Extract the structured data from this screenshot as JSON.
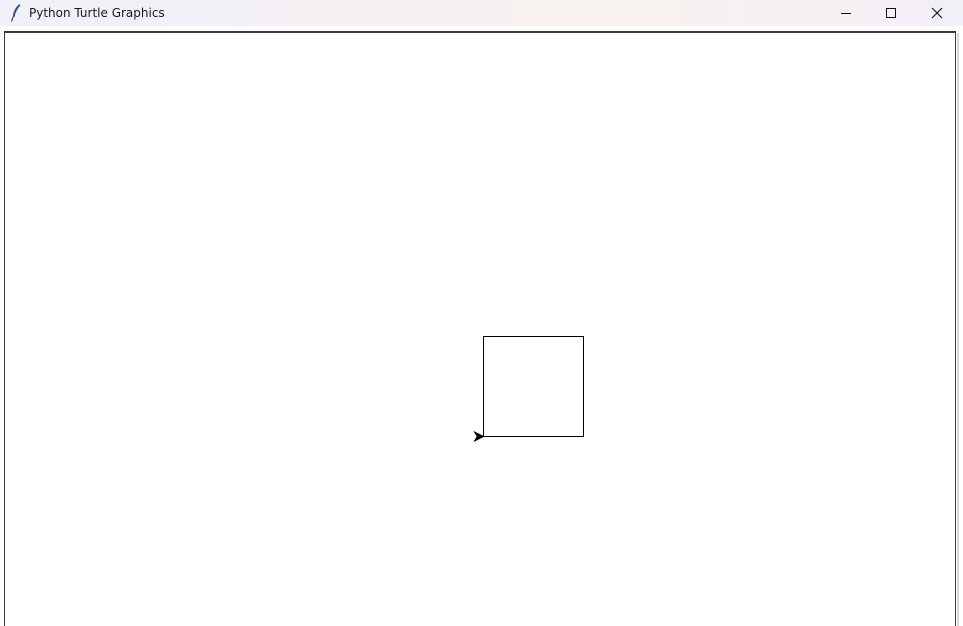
{
  "window": {
    "title": "Python Turtle Graphics",
    "icon": "feather-icon",
    "controls": {
      "minimize": "minimize-icon",
      "maximize": "maximize-icon",
      "close": "close-icon"
    }
  },
  "canvas": {
    "background": "#ffffff",
    "pen_color": "#000000",
    "turtle_shape": "classic-arrow",
    "turtle_heading": "east",
    "drawn_shape": "square"
  }
}
